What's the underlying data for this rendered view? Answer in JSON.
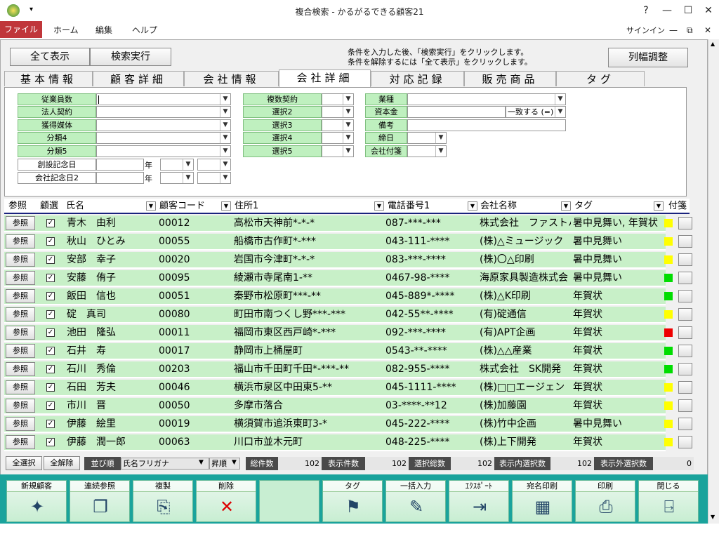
{
  "window": {
    "title": "複合検索 - かるがるできる顧客21",
    "help": "?",
    "signin": "サインイン"
  },
  "ribbon": {
    "tabs": [
      "ファイル",
      "ホーム",
      "編集",
      "ヘルプ"
    ]
  },
  "toolbar": {
    "show_all": "全て表示",
    "search": "検索実行",
    "col_adjust": "列幅調整",
    "hint1": "条件を入力した後、「検索実行」をクリックします。",
    "hint2": "条件を解除するには「全て表示」をクリックします。"
  },
  "page_tabs": [
    "基本情報",
    "顧客詳細",
    "会社情報",
    "会社詳細",
    "対応記録",
    "販売商品",
    "タグ"
  ],
  "active_tab": "会社詳細",
  "form": {
    "col1": [
      "従業員数",
      "法人契約",
      "獲得媒体",
      "分類4",
      "分類5"
    ],
    "anniv1": "創設記念日",
    "anniv2": "会社記念日2",
    "year": "年",
    "col2": [
      "複数契約",
      "選択2",
      "選択3",
      "選択4",
      "選択5"
    ],
    "col3": [
      "業種",
      "資本金",
      "備考",
      "締日",
      "会社付箋"
    ],
    "match": "一致する (=)"
  },
  "grid": {
    "headers": {
      "ref": "参照",
      "select": "顧選",
      "name": "氏名",
      "code": "顧客コード",
      "address": "住所1",
      "phone": "電話番号1",
      "company": "会社名称",
      "tag": "タグ",
      "sticky": "付箋"
    },
    "ref_label": "参照",
    "rows": [
      {
        "name": "青木　由利",
        "code": "00012",
        "address": "高松市天神前*-*-*",
        "phone": "087-***-***",
        "company": "株式会社　ファストハ",
        "tag": "暑中見舞い, 年賀状",
        "color": "#ffff00"
      },
      {
        "name": "秋山　ひとみ",
        "code": "00055",
        "address": "船橋市古作町*-***",
        "phone": "043-111-****",
        "company": "(株)△ミュージック",
        "tag": "暑中見舞い",
        "color": "#ffff00"
      },
      {
        "name": "安部　幸子",
        "code": "00020",
        "address": "岩国市今津町*-*-*",
        "phone": "083-***-****",
        "company": "(株)〇△印刷",
        "tag": "暑中見舞い",
        "color": "#ffff00"
      },
      {
        "name": "安藤　侑子",
        "code": "00095",
        "address": "綾瀬市寺尾南1-**",
        "phone": "0467-98-****",
        "company": "海原家具製造株式会",
        "tag": "暑中見舞い",
        "color": "#00dd00"
      },
      {
        "name": "飯田　信也",
        "code": "00051",
        "address": "秦野市松原町***-**",
        "phone": "045-889*-****",
        "company": "(株)△K印刷",
        "tag": "年賀状",
        "color": "#00dd00"
      },
      {
        "name": "碇　真司",
        "code": "00080",
        "address": "町田市南つくし野***-***",
        "phone": "042-55**-****",
        "company": "(有)碇通信",
        "tag": "年賀状",
        "color": "#ffff00"
      },
      {
        "name": "池田　隆弘",
        "code": "00011",
        "address": "福岡市東区西戸崎*-***",
        "phone": "092-***-****",
        "company": "(有)APT企画",
        "tag": "年賀状",
        "color": "#ee0000"
      },
      {
        "name": "石井　寿",
        "code": "00017",
        "address": "静岡市上桶屋町",
        "phone": "0543-**-****",
        "company": "(株)△△産業",
        "tag": "年賀状",
        "color": "#00dd00"
      },
      {
        "name": "石川　秀倫",
        "code": "00203",
        "address": "福山市千田町千田*-***-**",
        "phone": "082-955-****",
        "company": "株式会社　SK開発",
        "tag": "年賀状",
        "color": "#00dd00"
      },
      {
        "name": "石田　芳夫",
        "code": "00046",
        "address": "横浜市泉区中田東5-**",
        "phone": "045-1111-****",
        "company": "(株)□□エージェン",
        "tag": "年賀状",
        "color": "#ffff00"
      },
      {
        "name": "市川　晋",
        "code": "00050",
        "address": "多摩市落合",
        "phone": "03-****-**12",
        "company": "(株)加藤園",
        "tag": "年賀状",
        "color": "#ffff00"
      },
      {
        "name": "伊藤　絵里",
        "code": "00019",
        "address": "横須賀市追浜東町3-*",
        "phone": "045-222-****",
        "company": "(株)竹中企画",
        "tag": "暑中見舞い",
        "color": "#ffff00"
      },
      {
        "name": "伊藤　潤一郎",
        "code": "00063",
        "address": "川口市並木元町",
        "phone": "048-225-****",
        "company": "(株)上下開発",
        "tag": "年賀状",
        "color": "#ffff00"
      }
    ]
  },
  "status": {
    "select_all": "全選択",
    "deselect_all": "全解除",
    "sort_label": "並び順",
    "sort_field": "氏名フリガナ",
    "sort_order": "昇順",
    "total_label": "総件数",
    "total": "102",
    "shown_label": "表示件数",
    "shown": "102",
    "selected_label": "選択総数",
    "selected": "102",
    "in_sel_label": "表示内選択数",
    "in_sel": "102",
    "out_sel_label": "表示外選択数",
    "out_sel": "0"
  },
  "bottom_buttons": [
    {
      "label": "新規顧客",
      "icon": "new-customer-icon"
    },
    {
      "label": "連続参照",
      "icon": "continuous-view-icon"
    },
    {
      "label": "複製",
      "icon": "duplicate-icon"
    },
    {
      "label": "削除",
      "icon": "delete-icon"
    },
    {
      "label": "",
      "icon": ""
    },
    {
      "label": "タグ",
      "icon": "tag-icon"
    },
    {
      "label": "一括入力",
      "icon": "bulk-input-icon"
    },
    {
      "label": "ｴｸｽﾎﾟｰﾄ",
      "icon": "export-icon"
    },
    {
      "label": "宛名印刷",
      "icon": "address-print-icon"
    },
    {
      "label": "印刷",
      "icon": "print-icon"
    },
    {
      "label": "閉じる",
      "icon": "close-door-icon"
    }
  ]
}
